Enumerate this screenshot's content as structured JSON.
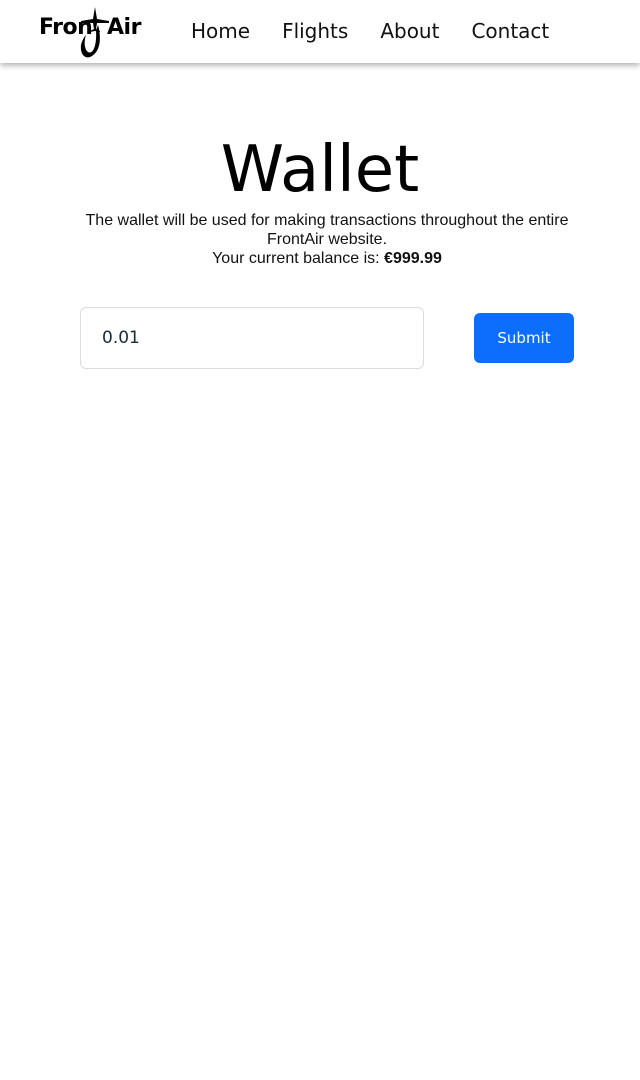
{
  "brand": {
    "logo_left": "Fron",
    "logo_right": "Air"
  },
  "nav": {
    "items": [
      {
        "label": "Home"
      },
      {
        "label": "Flights"
      },
      {
        "label": "About"
      },
      {
        "label": "Contact"
      }
    ]
  },
  "main": {
    "title": "Wallet",
    "description": "The wallet will be used for making transactions throughout the entire FrontAir website.",
    "balance_label": "Your current balance is: ",
    "balance_value": "€999.99"
  },
  "form": {
    "amount_value": "0.01",
    "submit_label": "Submit"
  },
  "colors": {
    "primary": "#0d6efd",
    "text": "#000000",
    "background": "#ffffff"
  }
}
